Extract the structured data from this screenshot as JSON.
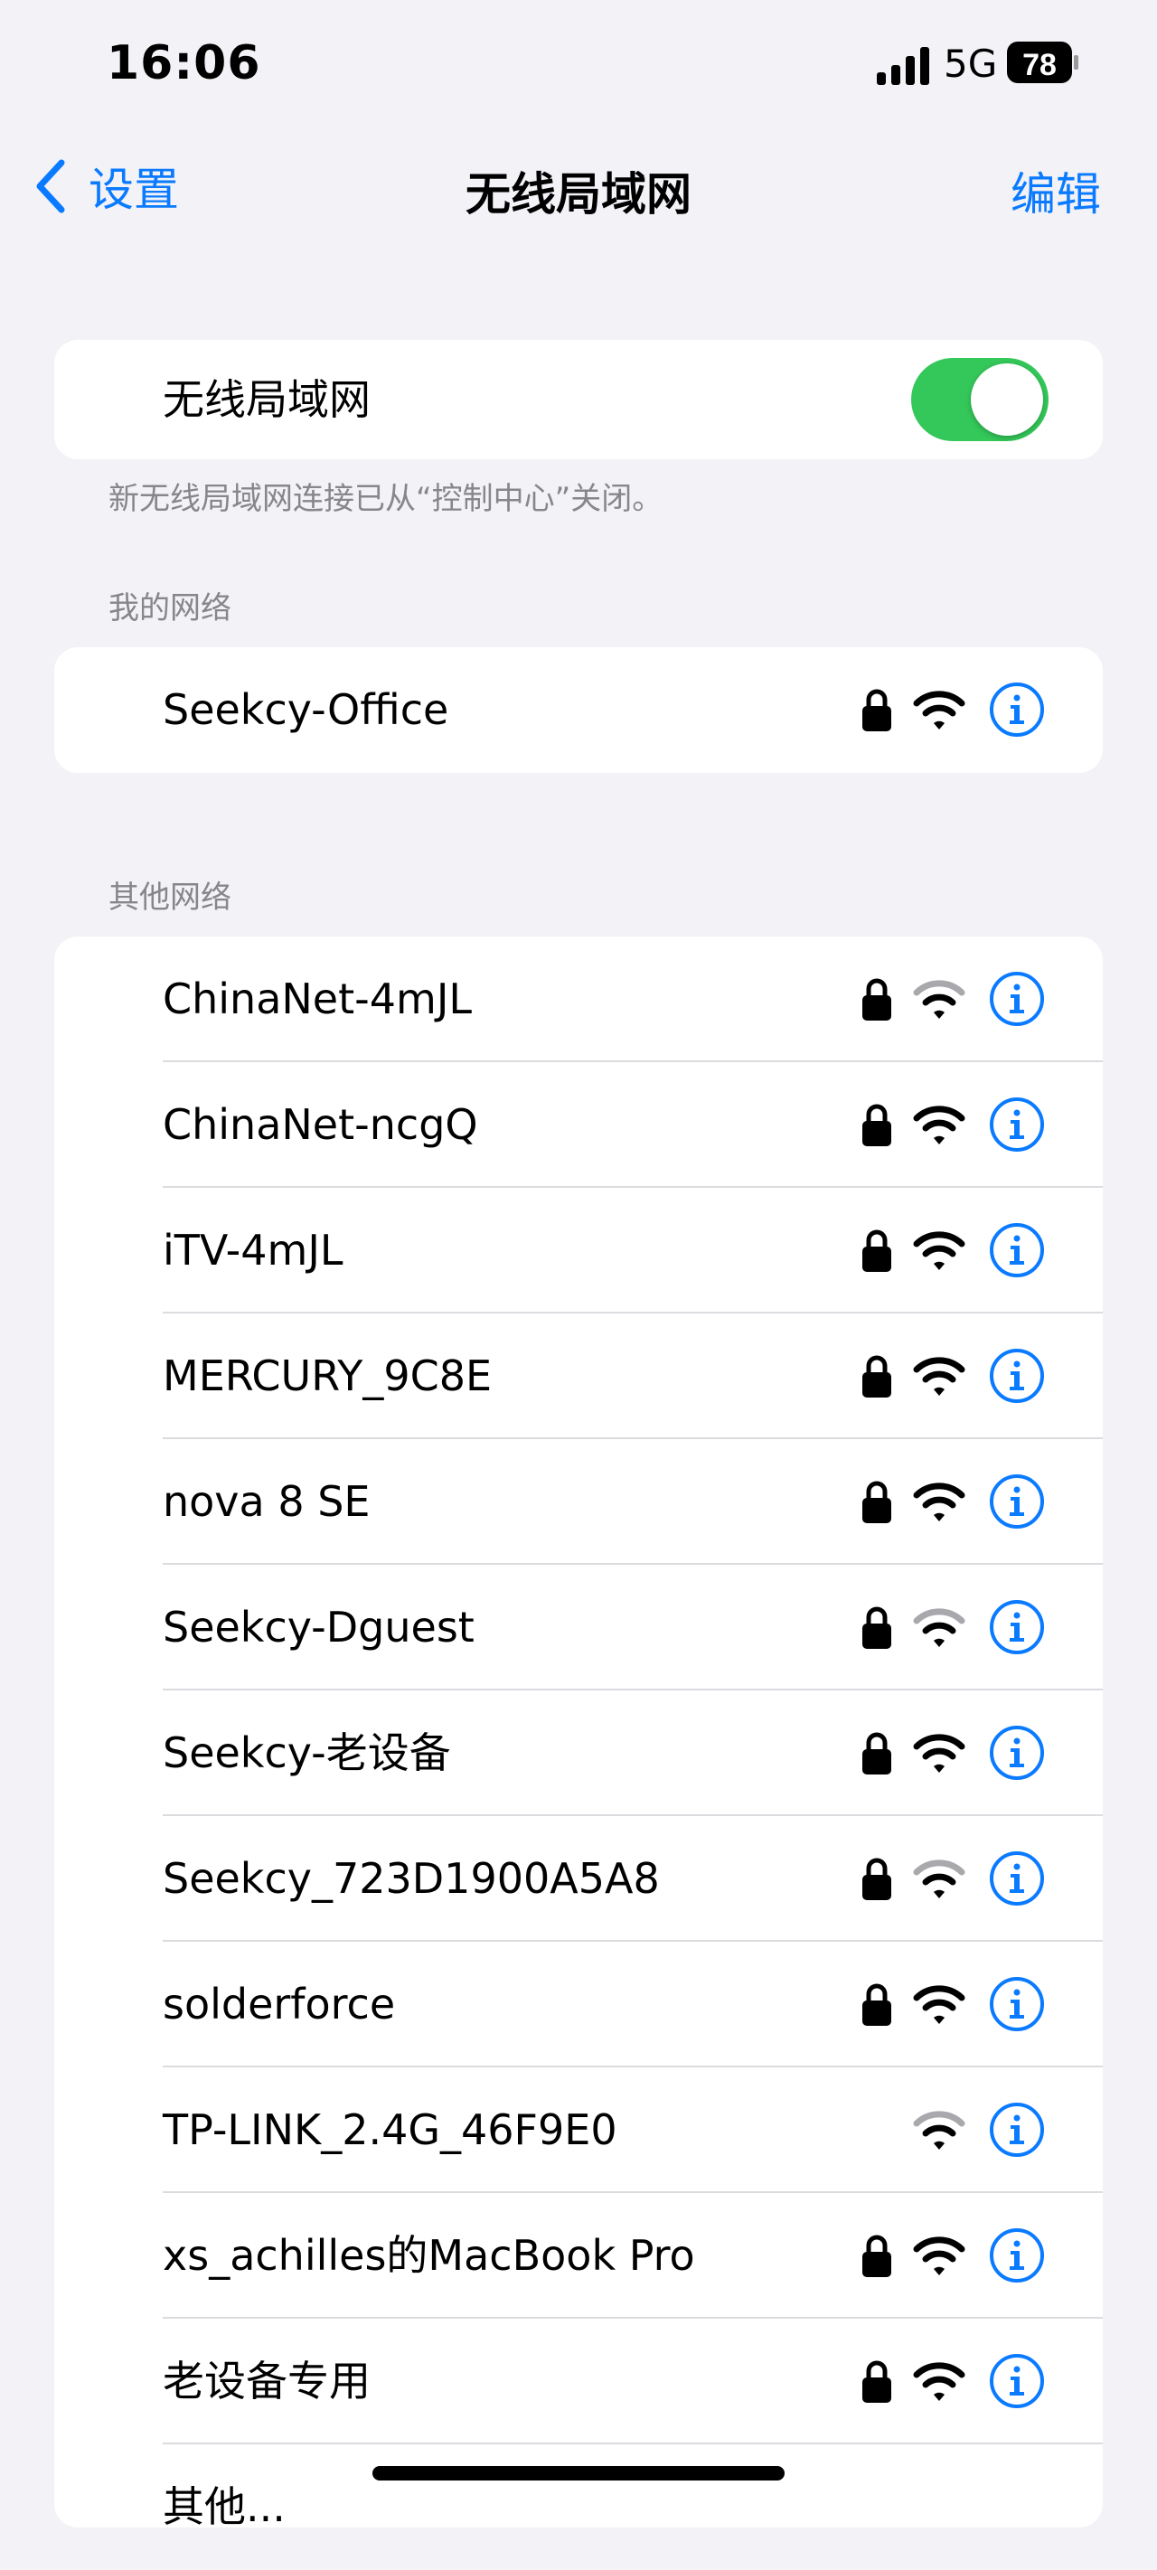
{
  "status": {
    "time": "16:06",
    "network": "5G",
    "battery": "78"
  },
  "nav": {
    "back_label": "设置",
    "title": "无线局域网",
    "edit_label": "编辑"
  },
  "wifi_toggle": {
    "label": "无线局域网",
    "on": true
  },
  "note": "新无线局域网连接已从“控制中心”关闭。",
  "my_networks": {
    "header": "我的网络",
    "items": [
      {
        "name": "Seekcy-Office",
        "locked": true,
        "signal": "strong"
      }
    ]
  },
  "other_networks": {
    "header": "其他网络",
    "items": [
      {
        "name": "ChinaNet-4mJL",
        "locked": true,
        "signal": "weak"
      },
      {
        "name": "ChinaNet-ncgQ",
        "locked": true,
        "signal": "strong"
      },
      {
        "name": "iTV-4mJL",
        "locked": true,
        "signal": "strong"
      },
      {
        "name": "MERCURY_9C8E",
        "locked": true,
        "signal": "strong"
      },
      {
        "name": "nova 8 SE",
        "locked": true,
        "signal": "strong"
      },
      {
        "name": "Seekcy-Dguest",
        "locked": true,
        "signal": "weak"
      },
      {
        "name": "Seekcy-老设备",
        "locked": true,
        "signal": "strong"
      },
      {
        "name": "Seekcy_723D1900A5A8",
        "locked": true,
        "signal": "weak"
      },
      {
        "name": "solderforce",
        "locked": true,
        "signal": "strong"
      },
      {
        "name": "TP-LINK_2.4G_46F9E0",
        "locked": false,
        "signal": "weak"
      },
      {
        "name": "xs_achilles的MacBook Pro",
        "locked": true,
        "signal": "strong"
      },
      {
        "name": "老设备专用",
        "locked": true,
        "signal": "strong"
      },
      {
        "name": "其他...",
        "locked": false,
        "signal": "none"
      }
    ]
  },
  "colors": {
    "accent": "#0a7aff",
    "toggle_on": "#34c759",
    "weak_signal": "#a8a8ad"
  }
}
